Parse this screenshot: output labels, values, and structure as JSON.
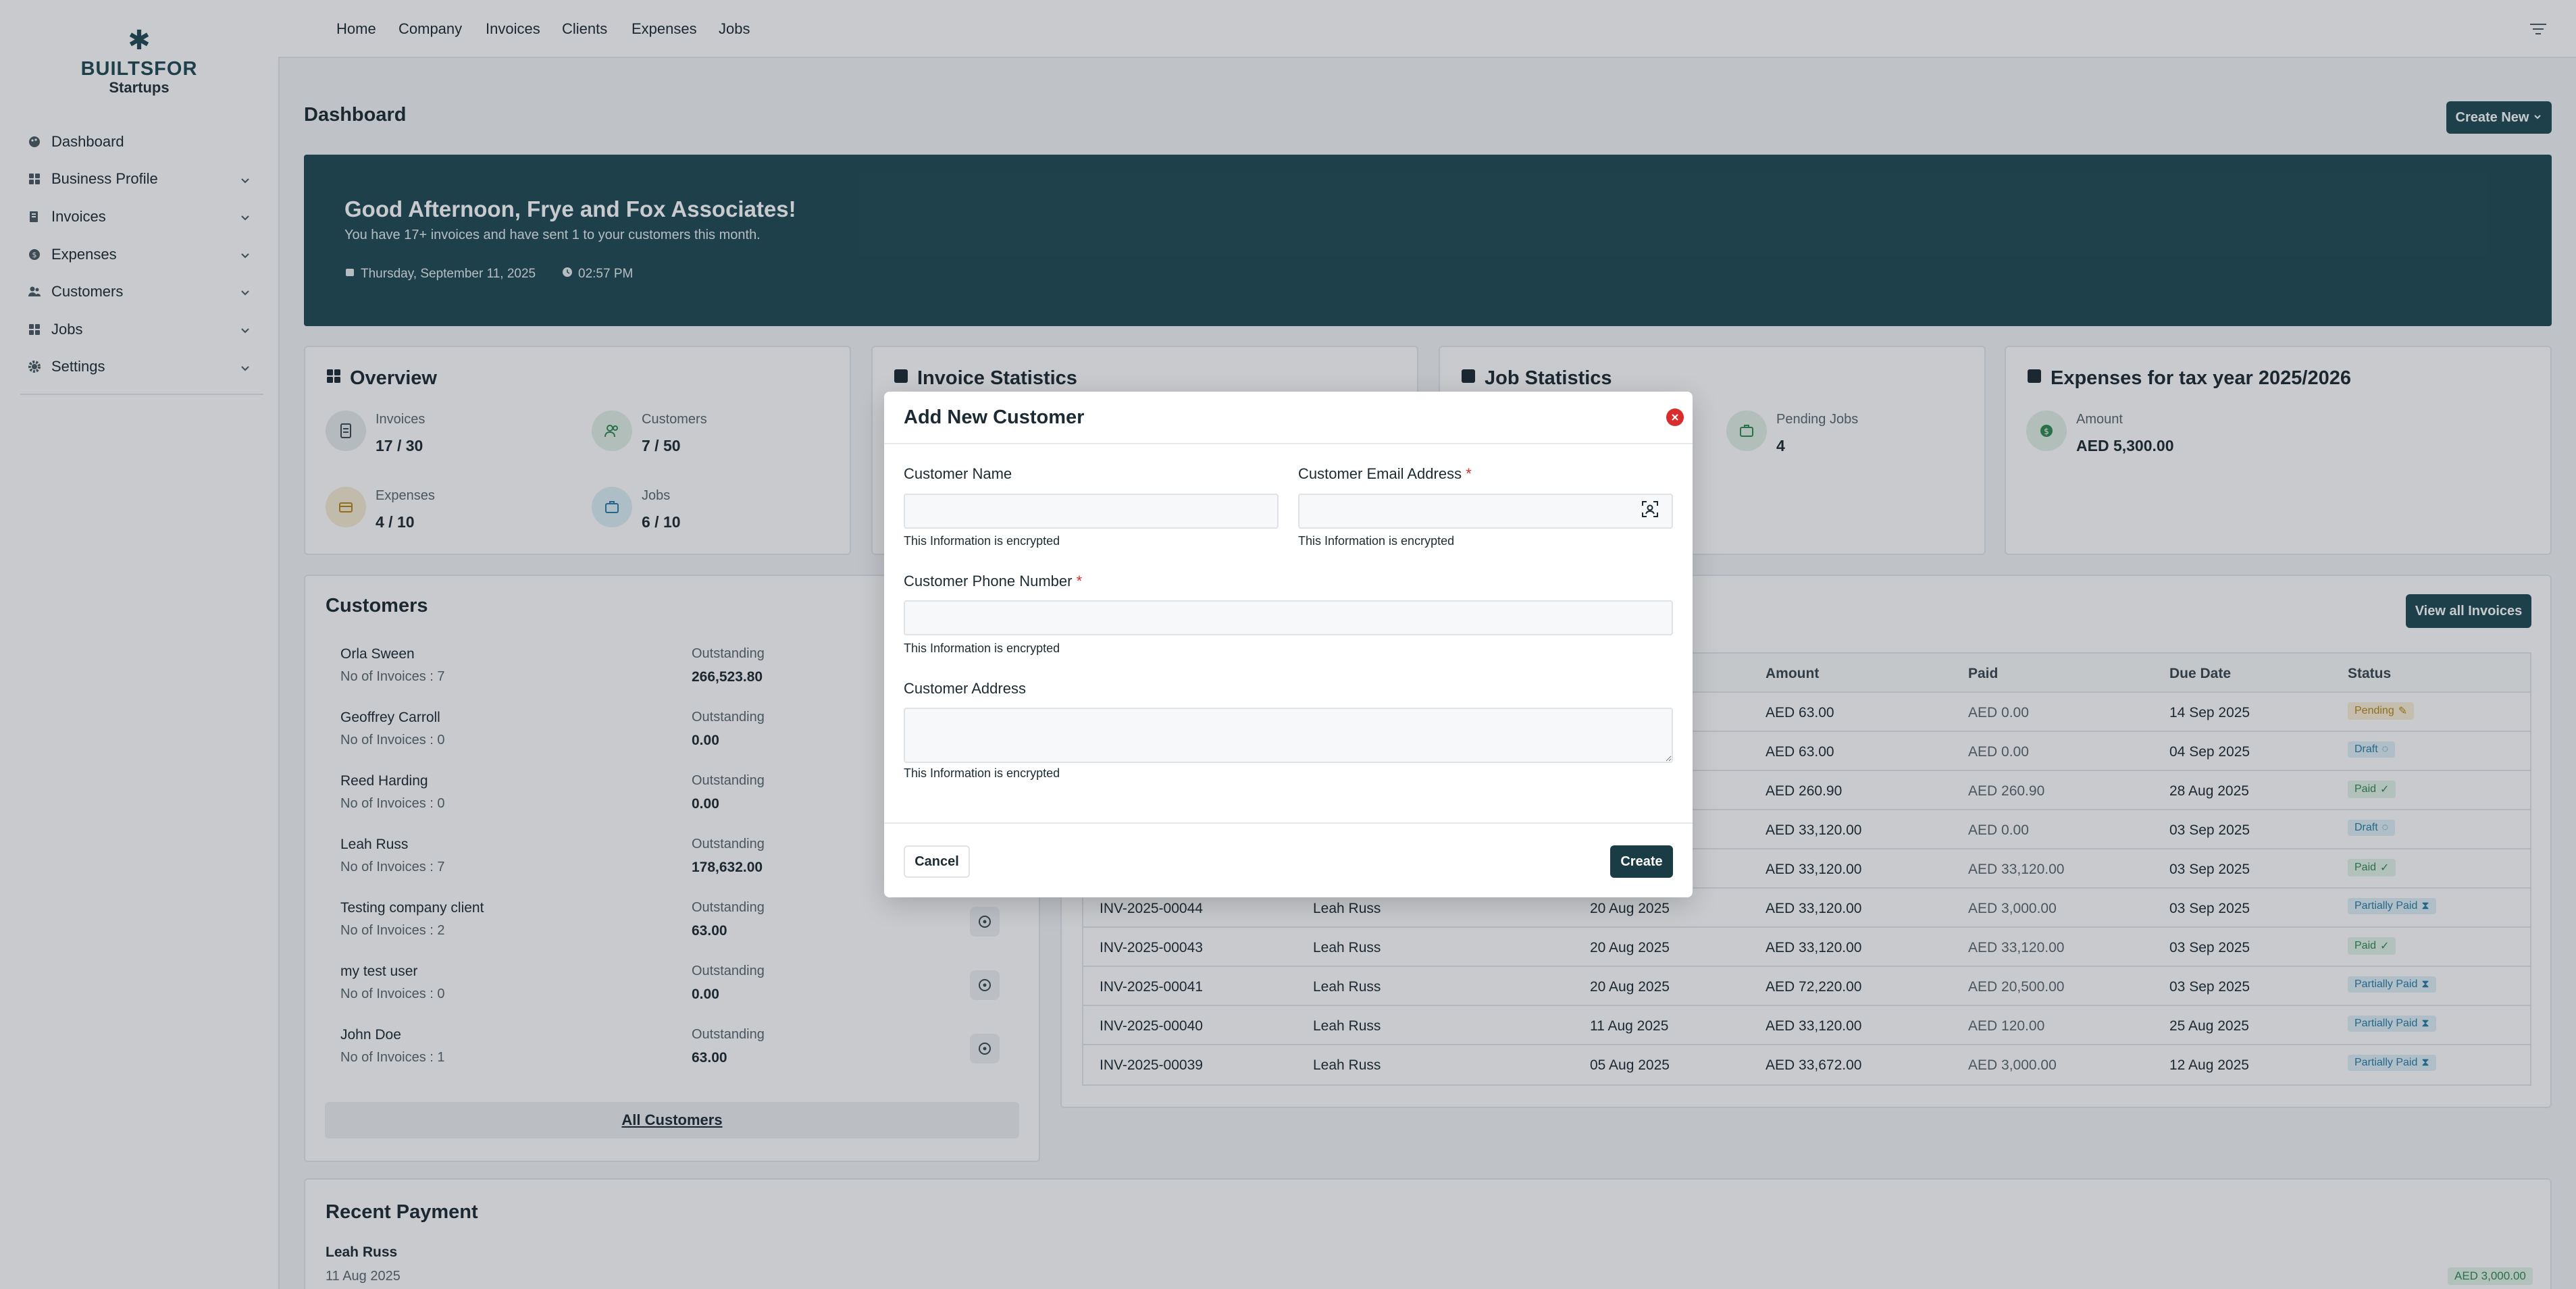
{
  "brand": {
    "line1": "BUILTSFOR",
    "line2": "Startups"
  },
  "sidebar": {
    "items": [
      {
        "label": "Dashboard",
        "icon": "palette-icon",
        "has_chevron": false
      },
      {
        "label": "Business Profile",
        "icon": "grid-icon",
        "has_chevron": true
      },
      {
        "label": "Invoices",
        "icon": "invoice-icon",
        "has_chevron": true
      },
      {
        "label": "Expenses",
        "icon": "expenses-icon",
        "has_chevron": true
      },
      {
        "label": "Customers",
        "icon": "users-icon",
        "has_chevron": true
      },
      {
        "label": "Jobs",
        "icon": "grid-icon",
        "has_chevron": true
      },
      {
        "label": "Settings",
        "icon": "gear-icon",
        "has_chevron": true
      }
    ]
  },
  "topnav": {
    "links": [
      "Home",
      "Company",
      "Invoices",
      "Clients",
      "Expenses",
      "Jobs"
    ]
  },
  "header": {
    "title": "Dashboard",
    "create_new": "Create New"
  },
  "banner": {
    "greeting": "Good Afternoon, Frye and Fox Associates!",
    "subtitle": "You have 17+ invoices and have sent 1 to your customers this month.",
    "date": "Thursday, September 11, 2025",
    "time": "02:57 PM"
  },
  "overview": {
    "title": "Overview",
    "stats": [
      {
        "label": "Invoices",
        "value": "17 / 30"
      },
      {
        "label": "Customers",
        "value": "7 / 50"
      },
      {
        "label": "Expenses",
        "value": "4 / 10"
      },
      {
        "label": "Jobs",
        "value": "6 / 10"
      }
    ]
  },
  "invoice_stats": {
    "title": "Invoice Statistics"
  },
  "job_stats": {
    "title": "Job Statistics",
    "pending_label": "Pending Jobs",
    "pending_value": "4"
  },
  "expenses_card": {
    "title": "Expenses for tax year 2025/2026",
    "amount_label": "Amount",
    "amount_value": "AED 5,300.00"
  },
  "customers": {
    "title": "Customers",
    "outstanding_label": "Outstanding",
    "rows": [
      {
        "name": "Orla Sween",
        "count": "No of Invoices : 7",
        "outstanding": "266,523.80"
      },
      {
        "name": "Geoffrey Carroll",
        "count": "No of Invoices : 0",
        "outstanding": "0.00"
      },
      {
        "name": "Reed Harding",
        "count": "No of Invoices : 0",
        "outstanding": "0.00"
      },
      {
        "name": "Leah Russ",
        "count": "No of Invoices : 7",
        "outstanding": "178,632.00"
      },
      {
        "name": "Testing company client",
        "count": "No of Invoices : 2",
        "outstanding": "63.00"
      },
      {
        "name": "my test user",
        "count": "No of Invoices : 0",
        "outstanding": "0.00"
      },
      {
        "name": "John Doe",
        "count": "No of Invoices : 1",
        "outstanding": "63.00"
      }
    ],
    "all_link": "All Customers"
  },
  "invoices": {
    "view_all": "View all Invoices",
    "headers": {
      "amount": "Amount",
      "paid": "Paid",
      "due": "Due Date",
      "status": "Status"
    },
    "rows": [
      {
        "number": "",
        "customer": "",
        "date": "",
        "amount": "AED 63.00",
        "paid": "AED 0.00",
        "due": "14 Sep 2025",
        "status": "Pending",
        "kind": "pending"
      },
      {
        "number": "",
        "customer": "",
        "date": "",
        "amount": "AED 63.00",
        "paid": "AED 0.00",
        "due": "04 Sep 2025",
        "status": "Draft",
        "kind": "draft"
      },
      {
        "number": "",
        "customer": "",
        "date": "",
        "amount": "AED 260.90",
        "paid": "AED 260.90",
        "due": "28 Aug 2025",
        "status": "Paid",
        "kind": "paid"
      },
      {
        "number": "",
        "customer": "",
        "date": "",
        "amount": "AED 33,120.00",
        "paid": "AED 0.00",
        "due": "03 Sep 2025",
        "status": "Draft",
        "kind": "draft"
      },
      {
        "number": "",
        "customer": "",
        "date": "",
        "amount": "AED 33,120.00",
        "paid": "AED 33,120.00",
        "due": "03 Sep 2025",
        "status": "Paid",
        "kind": "paid"
      },
      {
        "number": "INV-2025-00044",
        "customer": "Leah Russ",
        "date": "20 Aug 2025",
        "amount": "AED 33,120.00",
        "paid": "AED 3,000.00",
        "due": "03 Sep 2025",
        "status": "Partially Paid",
        "kind": "partial"
      },
      {
        "number": "INV-2025-00043",
        "customer": "Leah Russ",
        "date": "20 Aug 2025",
        "amount": "AED 33,120.00",
        "paid": "AED 33,120.00",
        "due": "03 Sep 2025",
        "status": "Paid",
        "kind": "paid"
      },
      {
        "number": "INV-2025-00041",
        "customer": "Leah Russ",
        "date": "20 Aug 2025",
        "amount": "AED 72,220.00",
        "paid": "AED 20,500.00",
        "due": "03 Sep 2025",
        "status": "Partially Paid",
        "kind": "partial"
      },
      {
        "number": "INV-2025-00040",
        "customer": "Leah Russ",
        "date": "11 Aug 2025",
        "amount": "AED 33,120.00",
        "paid": "AED 120.00",
        "due": "25 Aug 2025",
        "status": "Partially Paid",
        "kind": "partial"
      },
      {
        "number": "INV-2025-00039",
        "customer": "Leah Russ",
        "date": "05 Aug 2025",
        "amount": "AED 33,672.00",
        "paid": "AED 3,000.00",
        "due": "12 Aug 2025",
        "status": "Partially Paid",
        "kind": "partial"
      }
    ]
  },
  "recent_payment": {
    "title": "Recent Payment",
    "name": "Leah Russ",
    "date": "11 Aug 2025",
    "amount": "AED 3,000.00"
  },
  "modal": {
    "title": "Add New Customer",
    "name_label": "Customer Name",
    "name_value": "",
    "email_label": "Customer Email Address",
    "email_value": "",
    "phone_label": "Customer Phone Number",
    "phone_value": "",
    "address_label": "Customer Address",
    "address_value": "",
    "required_mark": "*",
    "encrypted_note": "This Information is encrypted",
    "cancel": "Cancel",
    "create": "Create"
  },
  "colors": {
    "primary": "#1f4a55",
    "danger": "#d92d2d",
    "paid": "#2f8a52",
    "draft": "#2b7ea6",
    "pending": "#b98716"
  }
}
